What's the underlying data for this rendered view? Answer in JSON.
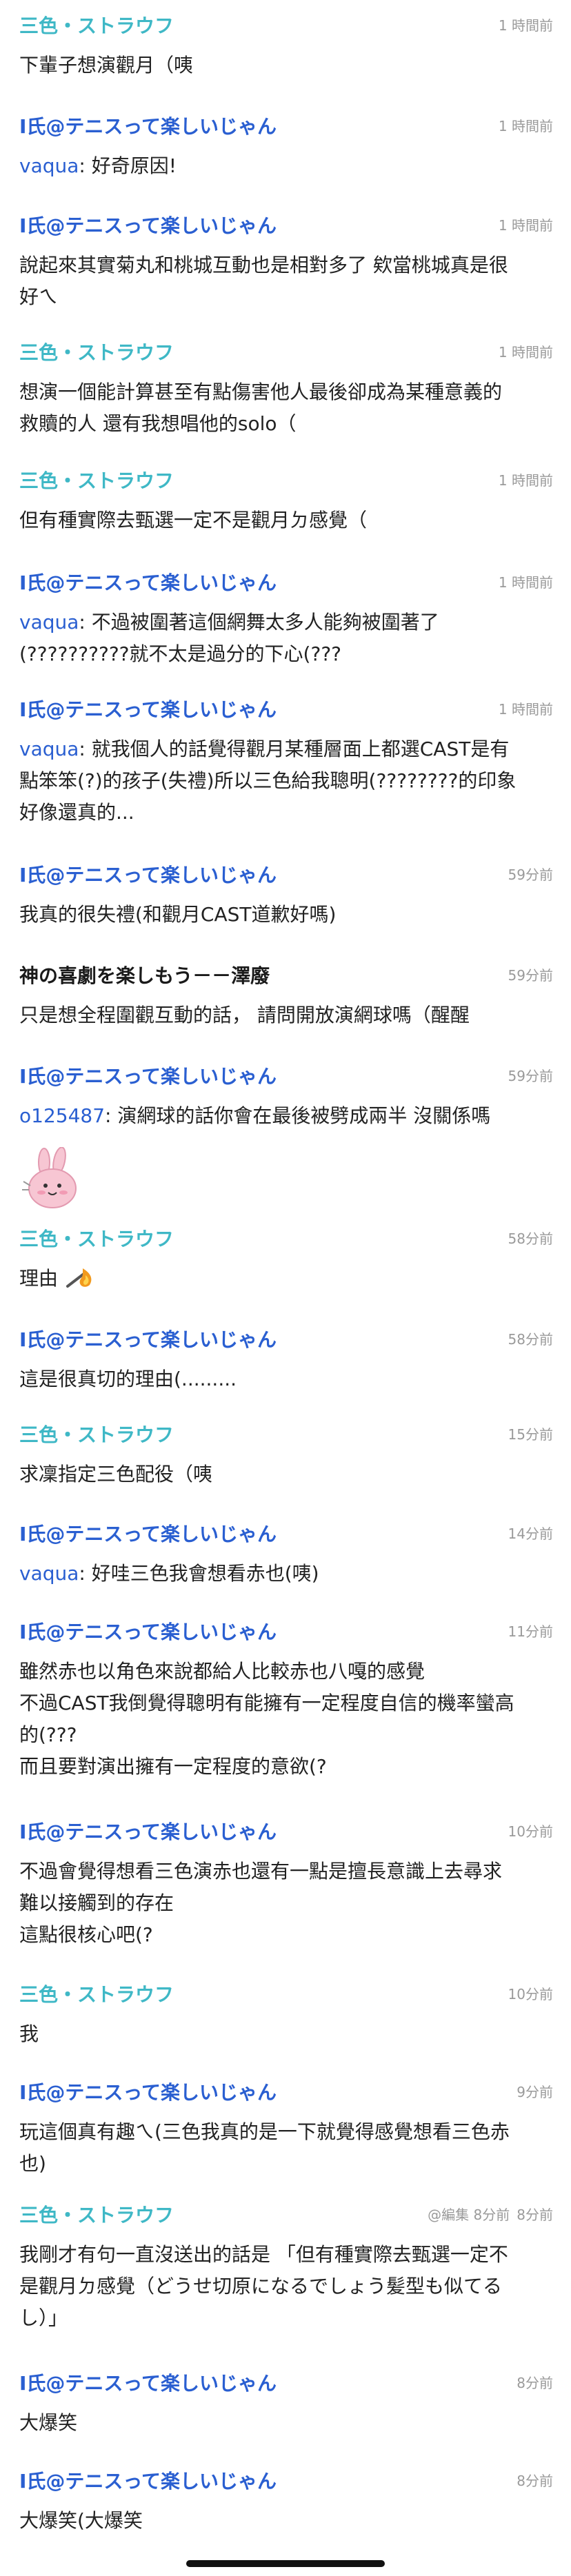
{
  "colors": {
    "sanshoku": "#3fb8c6",
    "ishi": "#2a5fd1",
    "kami": "#1a1a1a",
    "mention": "#2a5fd1",
    "text": "#222222",
    "timestamp": "#9a9a9a"
  },
  "comments": [
    {
      "author": "三色・ストラウフ",
      "author_style": "sanshoku",
      "time": "1 時間前",
      "lines": [
        "下輩子想演觀月（咦"
      ]
    },
    {
      "author": "I氏@テニスって楽しいじゃん",
      "author_style": "ishi",
      "time": "1 時間前",
      "mention": "vaqua",
      "lines": [
        "好奇原因!"
      ]
    },
    {
      "author": "I氏@テニスって楽しいじゃん",
      "author_style": "ishi",
      "time": "1 時間前",
      "lines": [
        "說起來其實菊丸和桃城互動也是相對多了 欸當桃城真是很",
        "好ㄟ"
      ]
    },
    {
      "author": "三色・ストラウフ",
      "author_style": "sanshoku",
      "time": "1 時間前",
      "lines": [
        "想演一個能計算甚至有點傷害他人最後卻成為某種意義的",
        "救贖的人 還有我想唱他的solo（"
      ]
    },
    {
      "author": "三色・ストラウフ",
      "author_style": "sanshoku",
      "time": "1 時間前",
      "lines": [
        "但有種實際去甄選一定不是觀月ㄉ感覺（"
      ]
    },
    {
      "author": "I氏@テニスって楽しいじゃん",
      "author_style": "ishi",
      "time": "1 時間前",
      "mention": "vaqua",
      "lines": [
        "不過被圍著這個網舞太多人能夠被圍著了",
        "(??????????就不太是過分的下心(???"
      ]
    },
    {
      "author": "I氏@テニスって楽しいじゃん",
      "author_style": "ishi",
      "time": "1 時間前",
      "mention": "vaqua",
      "lines": [
        "就我個人的話覺得觀月某種層面上都選CAST是有",
        "點笨笨(?)的孩子(失禮)所以三色給我聰明(????????的印象",
        "好像還真的..."
      ]
    },
    {
      "author": "I氏@テニスって楽しいじゃん",
      "author_style": "ishi",
      "time": "59分前",
      "lines": [
        "我真的很失禮(和觀月CAST道歉好嗎)"
      ]
    },
    {
      "author": "神の喜劇を楽しもう－－澤廢",
      "author_style": "kami",
      "time": "59分前",
      "lines": [
        "只是想全程圍觀互動的話， 請問開放演網球嗎（醒醒"
      ]
    },
    {
      "author": "I氏@テニスって楽しいじゃん",
      "author_style": "ishi",
      "time": "59分前",
      "mention": "o125487",
      "lines": [
        "演網球的話你會在最後被劈成兩半 沒關係嗎"
      ],
      "sticker": "pink-bunny-sticker"
    },
    {
      "author": "三色・ストラウフ",
      "author_style": "sanshoku",
      "time": "58分前",
      "lines": [
        "理由"
      ],
      "inline_icon": "fire-emoji"
    },
    {
      "author": "I氏@テニスって楽しいじゃん",
      "author_style": "ishi",
      "time": "58分前",
      "lines": [
        "這是很真切的理由(........."
      ]
    },
    {
      "author": "三色・ストラウフ",
      "author_style": "sanshoku",
      "time": "15分前",
      "lines": [
        "求凜指定三色配役（咦"
      ]
    },
    {
      "author": "I氏@テニスって楽しいじゃん",
      "author_style": "ishi",
      "time": "14分前",
      "mention": "vaqua",
      "lines": [
        "好哇三色我會想看赤也(咦)"
      ]
    },
    {
      "author": "I氏@テニスって楽しいじゃん",
      "author_style": "ishi",
      "time": "11分前",
      "lines": [
        "雖然赤也以角色來說都給人比較赤也八嘎的感覺",
        "不過CAST我倒覺得聰明有能擁有一定程度自信的機率蠻高",
        "的(???",
        "而且要對演出擁有一定程度的意欲(?"
      ]
    },
    {
      "author": "I氏@テニスって楽しいじゃん",
      "author_style": "ishi",
      "time": "10分前",
      "lines": [
        "不過會覺得想看三色演赤也還有一點是擅長意識上去尋求",
        "難以接觸到的存在",
        "這點很核心吧(?"
      ]
    },
    {
      "author": "三色・ストラウフ",
      "author_style": "sanshoku",
      "time": "10分前",
      "lines": [
        "我"
      ]
    },
    {
      "author": "I氏@テニスって楽しいじゃん",
      "author_style": "ishi",
      "time": "9分前",
      "lines": [
        "玩這個真有趣ㄟ(三色我真的是一下就覺得感覺想看三色赤",
        "也)"
      ]
    },
    {
      "author": "三色・ストラウフ",
      "author_style": "sanshoku",
      "time": "8分前",
      "edited": "@編集 8分前",
      "lines": [
        "我剛才有句一直沒送出的話是 「但有種實際去甄選一定不",
        "是觀月ㄉ感覺（どうせ切原になるでしょう髪型も似てる",
        "し）」"
      ]
    },
    {
      "author": "I氏@テニスって楽しいじゃん",
      "author_style": "ishi",
      "time": "8分前",
      "lines": [
        "大爆笑"
      ]
    },
    {
      "author": "I氏@テニスって楽しいじゃん",
      "author_style": "ishi",
      "time": "8分前",
      "lines": [
        "大爆笑(大爆笑"
      ]
    }
  ]
}
